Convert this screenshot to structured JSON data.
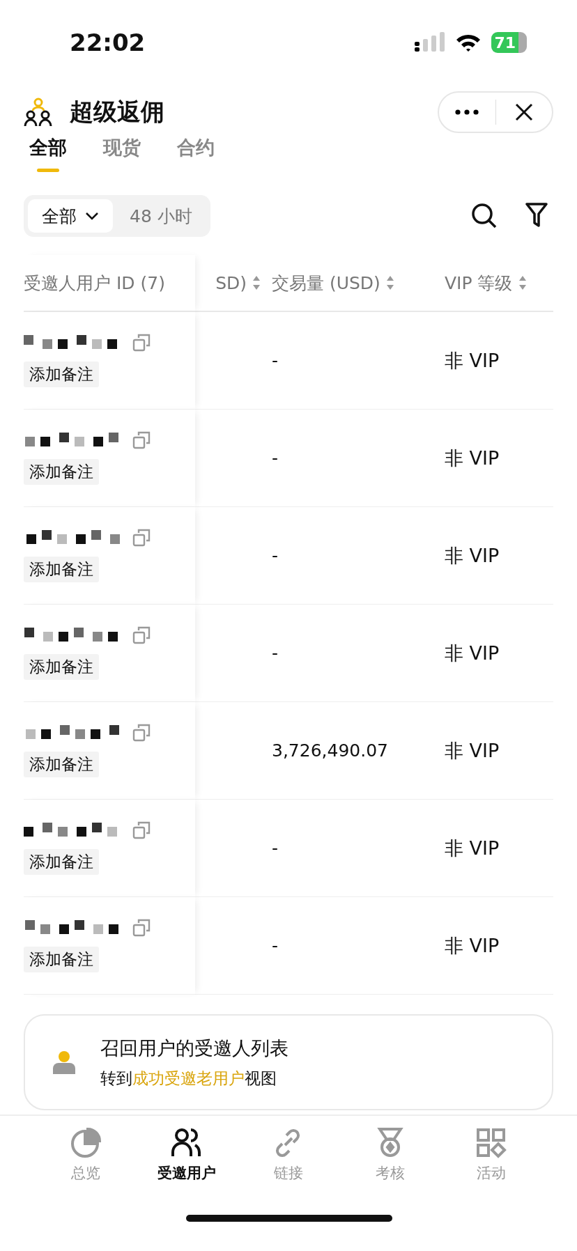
{
  "status_bar": {
    "time": "22:02",
    "battery": "71"
  },
  "header": {
    "title": "超级返佣"
  },
  "tabs": [
    {
      "label": "全部",
      "selected": true
    },
    {
      "label": "现货",
      "selected": false
    },
    {
      "label": "合约",
      "selected": false
    }
  ],
  "period": [
    {
      "label": "全部",
      "selected": true,
      "kind": "dropdown"
    },
    {
      "label": "48 小时",
      "selected": false,
      "kind": "plain"
    }
  ],
  "table": {
    "columns": [
      "受邀人用户 ID (7)",
      "SD)",
      "交易量 (USD)",
      "VIP 等级"
    ],
    "rows": [
      {
        "note": "添加备注",
        "volume": "-",
        "vip": "非 VIP"
      },
      {
        "note": "添加备注",
        "volume": "-",
        "vip": "非 VIP"
      },
      {
        "note": "添加备注",
        "volume": "-",
        "vip": "非 VIP"
      },
      {
        "note": "添加备注",
        "volume": "-",
        "vip": "非 VIP"
      },
      {
        "note": "添加备注",
        "volume": "3,726,490.07",
        "vip": "非 VIP"
      },
      {
        "note": "添加备注",
        "volume": "-",
        "vip": "非 VIP"
      },
      {
        "note": "添加备注",
        "volume": "-",
        "vip": "非 VIP"
      }
    ]
  },
  "recall_card": {
    "title": "召回用户的受邀人列表",
    "hint_start": "转到",
    "hint_link": "成功受邀老用户",
    "hint_end": "视图"
  },
  "nav": [
    {
      "label": "总览",
      "selected": false,
      "kind": "overview"
    },
    {
      "label": "受邀用户",
      "selected": true,
      "kind": "users"
    },
    {
      "label": "链接",
      "selected": false,
      "kind": "link"
    },
    {
      "label": "考核",
      "selected": false,
      "kind": "medal"
    },
    {
      "label": "活动",
      "selected": false,
      "kind": "apps"
    }
  ]
}
